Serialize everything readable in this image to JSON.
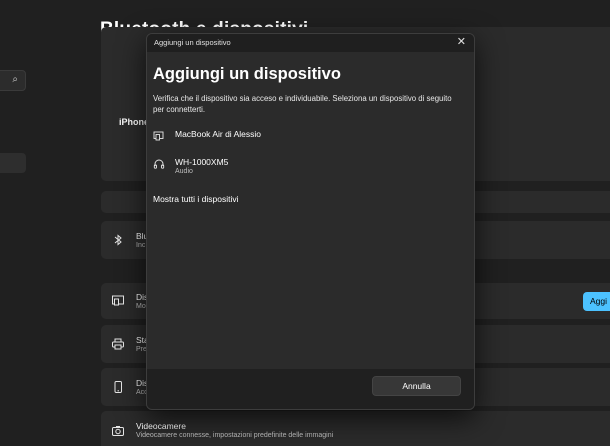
{
  "background": {
    "page_title": "Bluetooth e dispositivi",
    "search_icon": "search-icon",
    "top_card": {
      "device_label": "iPhone"
    },
    "bluetooth_card": {
      "title": "Blu",
      "subtitle": "Inc"
    },
    "devices_card": {
      "title": "Dis",
      "subtitle": "Mo",
      "button_label": "Aggi"
    },
    "printers_card": {
      "title": "Sta",
      "subtitle": "Pre"
    },
    "phone_card": {
      "title": "Dis",
      "subtitle": "Acc"
    },
    "camera_card": {
      "title": "Videocamere",
      "subtitle": "Videocamere connesse, impostazioni predefinite delle immagini"
    }
  },
  "dialog": {
    "window_title": "Aggiungi un dispositivo",
    "heading": "Aggiungi un dispositivo",
    "description": "Verifica che il dispositivo sia acceso e individuabile. Seleziona un dispositivo di seguito per connetterti.",
    "devices": [
      {
        "name": "MacBook Air di Alessio",
        "subtitle": "",
        "icon": "laptop-icon"
      },
      {
        "name": "WH-1000XM5",
        "subtitle": "Audio",
        "icon": "headphones-icon"
      }
    ],
    "show_all_label": "Mostra tutti i dispositivi",
    "cancel_label": "Annulla"
  },
  "colors": {
    "page_bg": "#202020",
    "card_bg": "#2b2b2b",
    "accent": "#4cc2ff",
    "dialog_bg": "#2b2b2b",
    "dialog_footer_bg": "#202020"
  }
}
